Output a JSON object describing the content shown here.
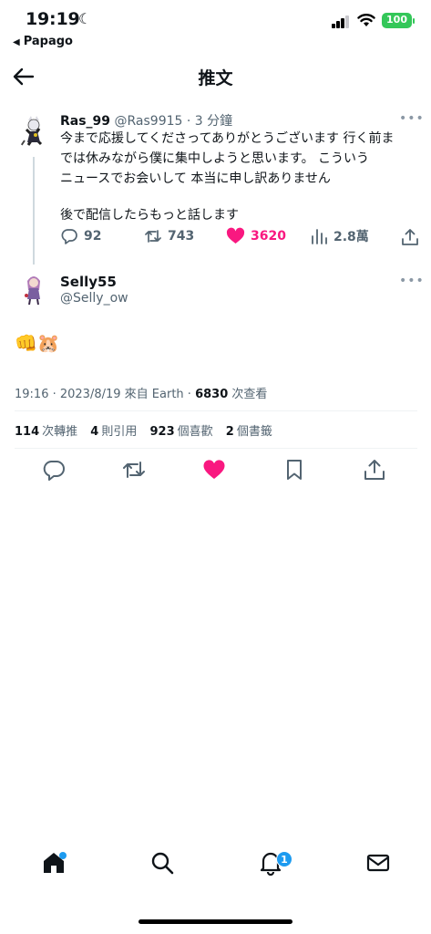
{
  "status": {
    "time": "19:19",
    "back_app": "Papago",
    "battery": "100"
  },
  "header": {
    "title": "推文"
  },
  "tweet1": {
    "name": "Ras_99",
    "handle": "@Ras9915",
    "time": "3 分鐘",
    "lines": [
      "今まで応援してくださってありがとうございます 行く前ま",
      "では休みながら僕に集中しようと思います。 こういう",
      "ニュースでお会いして 本当に申し訳ありません",
      "後で配信したらもっと話します"
    ],
    "replies": "92",
    "retweets": "743",
    "likes": "3620",
    "views": "2.8萬"
  },
  "tweet2": {
    "name": "Selly55",
    "handle": "@Selly_ow",
    "text": "👊🐹",
    "meta_time": "19:16 · 2023/8/19",
    "meta_source": "來自 Earth ·",
    "meta_views_count": "6830",
    "meta_views_label": "次查看",
    "stats": {
      "retweets_count": "114",
      "retweets_label": "次轉推",
      "quotes_count": "4",
      "quotes_label": "則引用",
      "likes_count": "923",
      "likes_label": "個喜歡",
      "bookmarks_count": "2",
      "bookmarks_label": "個書籤"
    }
  },
  "tabbar": {
    "notifications_badge": "1"
  },
  "icons": [
    "back-arrow-icon",
    "reply-icon",
    "retweet-icon",
    "heart-icon",
    "views-icon",
    "share-icon",
    "bookmark-icon",
    "home-icon",
    "search-icon",
    "bell-icon",
    "mail-icon"
  ],
  "colors": {
    "like": "#f91880",
    "accent": "#1d9bf0",
    "battery": "#34c759"
  }
}
